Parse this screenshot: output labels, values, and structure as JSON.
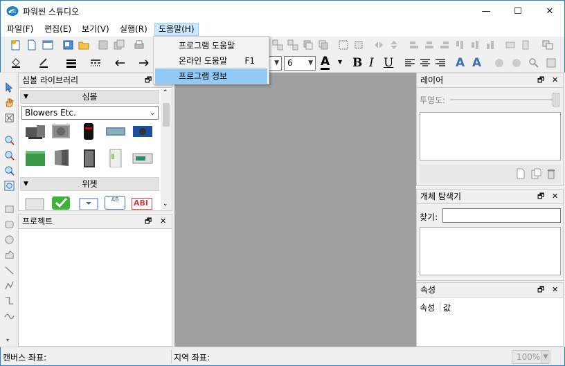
{
  "window": {
    "title": "파워씬 스튜디오",
    "minimize": "—",
    "maximize": "☐",
    "close": "✕"
  },
  "menu": [
    "파일(F)",
    "편집(E)",
    "보기(V)",
    "실행(R)",
    "도움말(H)"
  ],
  "help_menu": {
    "items": [
      {
        "label": "프로그램 도움말",
        "shortcut": ""
      },
      {
        "label": "온라인 도움말",
        "shortcut": "F1"
      },
      {
        "label": "프로그램 정보",
        "shortcut": ""
      }
    ]
  },
  "toolbar": {
    "font_size": "6",
    "font_size_left": "",
    "bold": "B",
    "italic": "I",
    "underline": "U",
    "text_color": "A",
    "fill_color": "#000000"
  },
  "symbol_library": {
    "title": "심볼 라이브러리",
    "section": "심볼",
    "category": "Blowers Etc.",
    "widget_section": "위젯",
    "widget_ab_label": "AB",
    "widget_abi_label": "ABI"
  },
  "project": {
    "title": "프로젝트"
  },
  "layer": {
    "title": "레이어",
    "transparency_label": "투명도:"
  },
  "object_explorer": {
    "title": "개체 탐색기",
    "find_label": "찾기:",
    "find_value": ""
  },
  "properties": {
    "title": "속성",
    "col_property": "속성",
    "col_value": "값"
  },
  "status": {
    "canvas_coords": "캔버스 좌표:",
    "region_coords": "지역 좌표:",
    "zoom": "100%"
  },
  "panel_buttons": {
    "pin": "🗗",
    "close": "✕"
  },
  "colors": {
    "accent": "#1883d7",
    "menu_highlight": "#91c9f7",
    "canvas": "#a0a0a0"
  }
}
